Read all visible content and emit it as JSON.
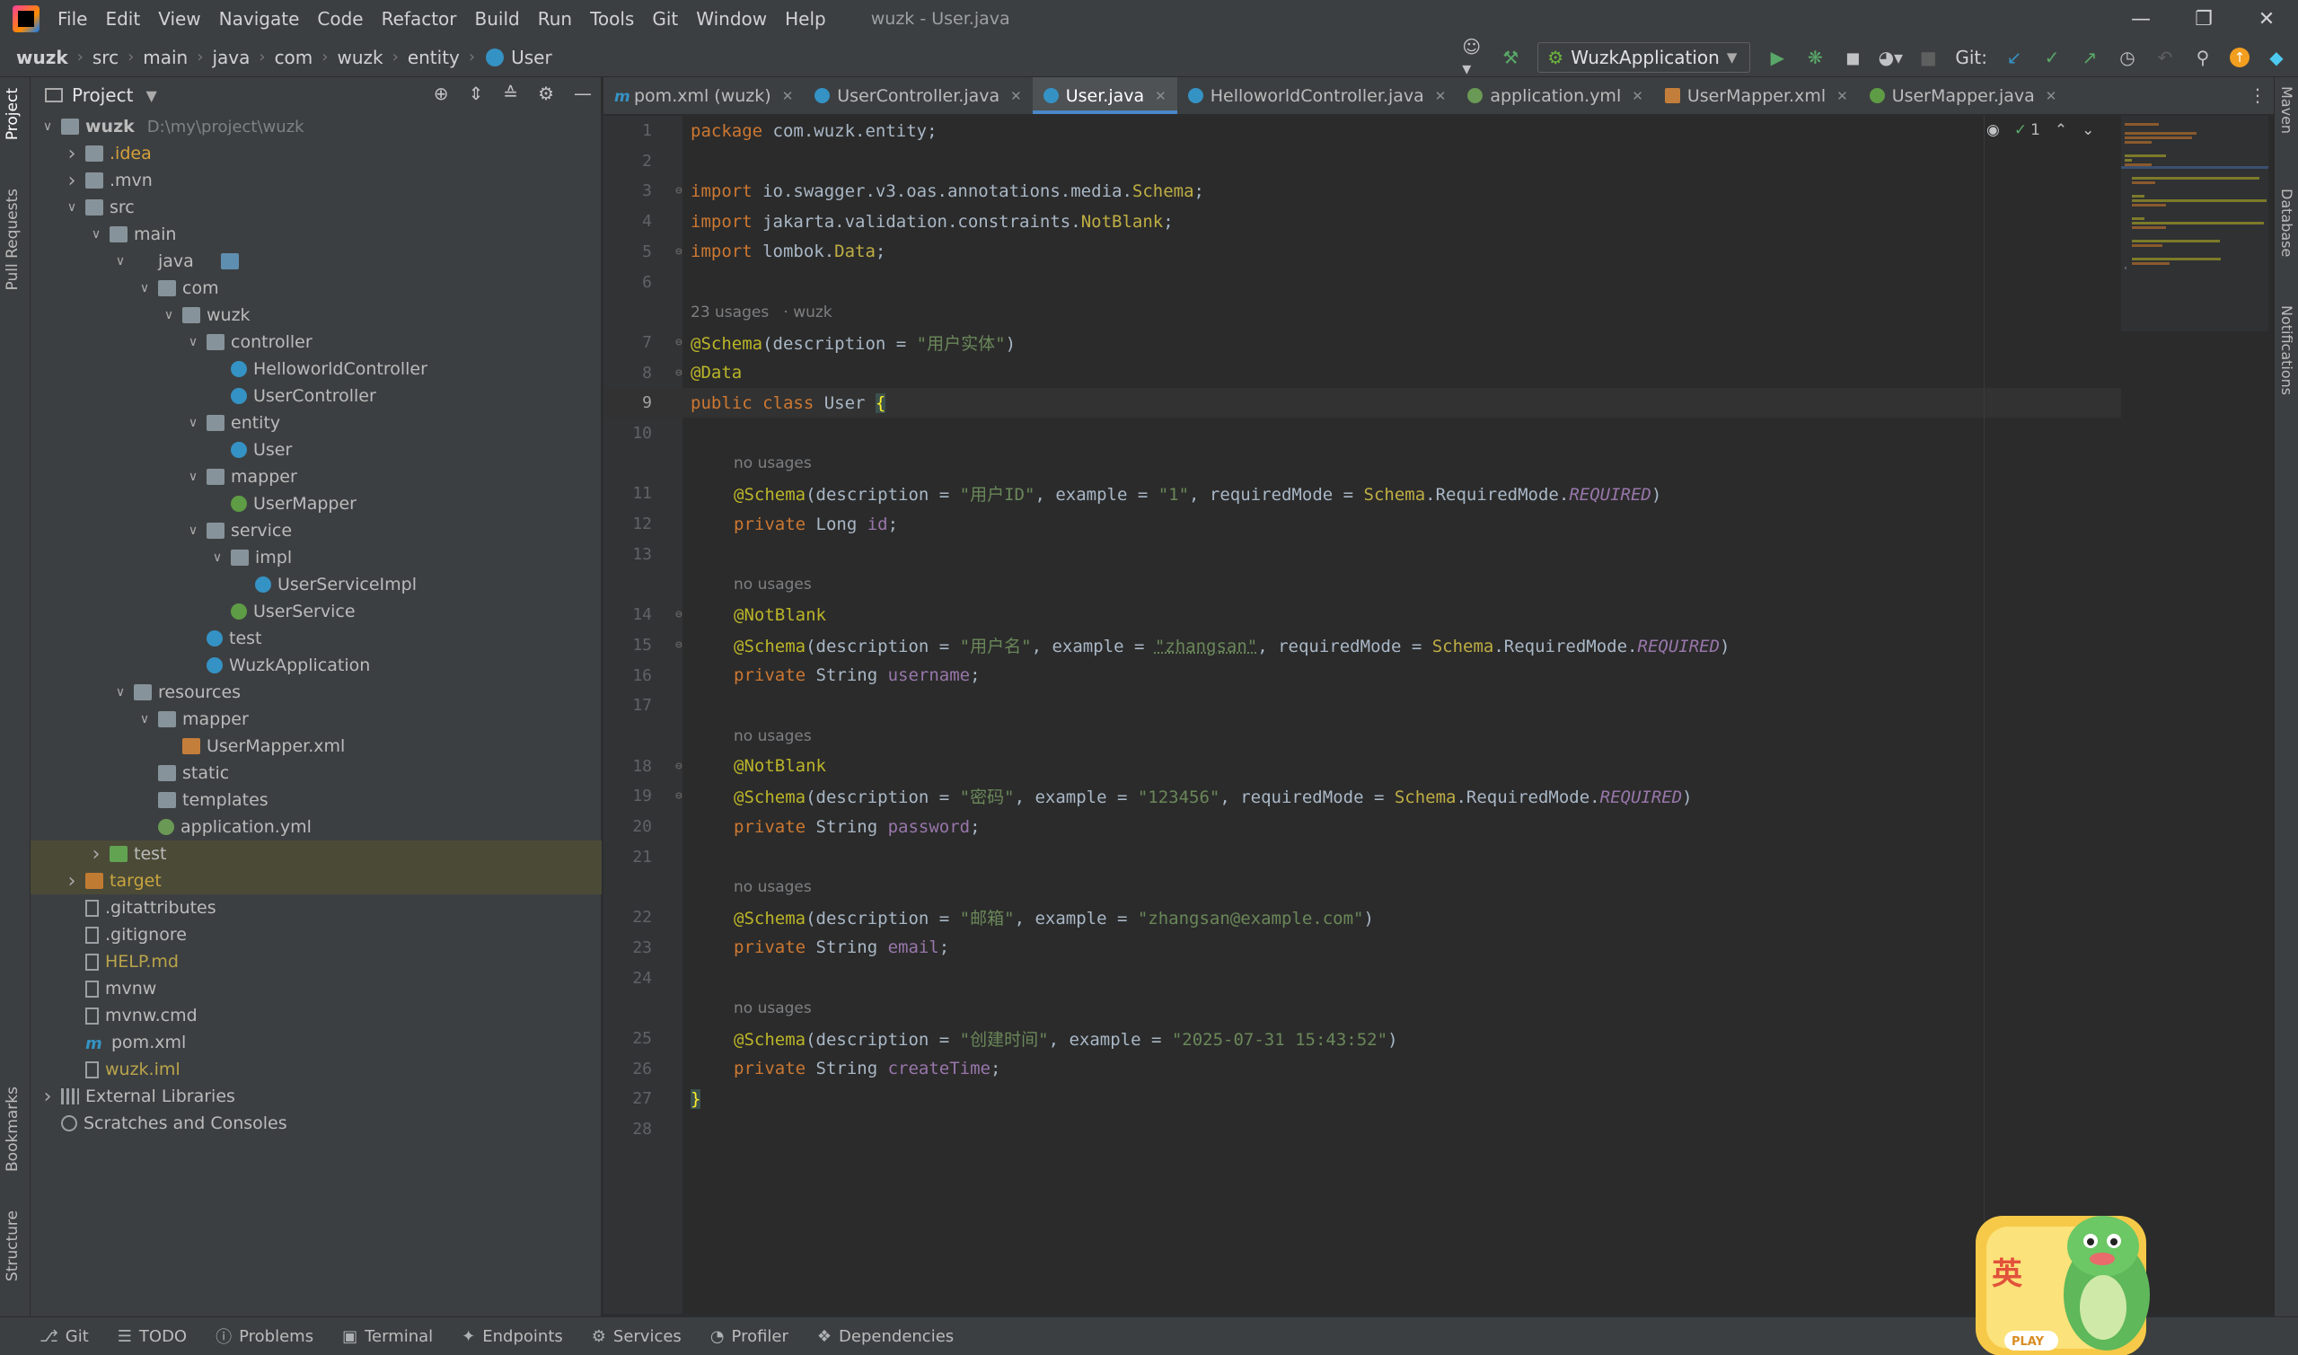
{
  "menubar": {
    "items": [
      "File",
      "Edit",
      "View",
      "Navigate",
      "Code",
      "Refactor",
      "Build",
      "Run",
      "Tools",
      "Git",
      "Window",
      "Help"
    ],
    "window_title": "wuzk - User.java"
  },
  "breadcrumb": [
    "wuzk",
    "src",
    "main",
    "java",
    "com",
    "wuzk",
    "entity",
    "User"
  ],
  "toolbar": {
    "run_config": "WuzkApplication",
    "git_label": "Git:"
  },
  "project_panel": {
    "title": "Project",
    "tree": [
      {
        "depth": 0,
        "label": "wuzk",
        "path": "D:\\my\\project\\wuzk",
        "icon": "module",
        "expanded": true,
        "bold": true
      },
      {
        "depth": 1,
        "label": ".idea",
        "icon": "folder",
        "expanded": false,
        "color": "orange"
      },
      {
        "depth": 1,
        "label": ".mvn",
        "icon": "folder",
        "expanded": false
      },
      {
        "depth": 1,
        "label": "src",
        "icon": "folder",
        "expanded": true
      },
      {
        "depth": 2,
        "label": "main",
        "icon": "folder",
        "expanded": true
      },
      {
        "depth": 3,
        "label": "java",
        "icon": "folder-src",
        "expanded": true
      },
      {
        "depth": 4,
        "label": "com",
        "icon": "folder",
        "expanded": true
      },
      {
        "depth": 5,
        "label": "wuzk",
        "icon": "folder",
        "expanded": true
      },
      {
        "depth": 6,
        "label": "controller",
        "icon": "folder",
        "expanded": true
      },
      {
        "depth": 7,
        "label": "HelloworldController",
        "icon": "class"
      },
      {
        "depth": 7,
        "label": "UserController",
        "icon": "class"
      },
      {
        "depth": 6,
        "label": "entity",
        "icon": "folder",
        "expanded": true
      },
      {
        "depth": 7,
        "label": "User",
        "icon": "class"
      },
      {
        "depth": 6,
        "label": "mapper",
        "icon": "folder",
        "expanded": true
      },
      {
        "depth": 7,
        "label": "UserMapper",
        "icon": "interface"
      },
      {
        "depth": 6,
        "label": "service",
        "icon": "folder",
        "expanded": true
      },
      {
        "depth": 7,
        "label": "impl",
        "icon": "folder",
        "expanded": true
      },
      {
        "depth": 8,
        "label": "UserServiceImpl",
        "icon": "class"
      },
      {
        "depth": 7,
        "label": "UserService",
        "icon": "interface"
      },
      {
        "depth": 6,
        "label": "test",
        "icon": "class"
      },
      {
        "depth": 6,
        "label": "WuzkApplication",
        "icon": "class"
      },
      {
        "depth": 3,
        "label": "resources",
        "icon": "folder",
        "expanded": true
      },
      {
        "depth": 4,
        "label": "mapper",
        "icon": "folder",
        "expanded": true
      },
      {
        "depth": 5,
        "label": "UserMapper.xml",
        "icon": "xml"
      },
      {
        "depth": 4,
        "label": "static",
        "icon": "folder"
      },
      {
        "depth": 4,
        "label": "templates",
        "icon": "folder"
      },
      {
        "depth": 4,
        "label": "application.yml",
        "icon": "yml"
      },
      {
        "depth": 2,
        "label": "test",
        "icon": "folder-green",
        "expanded": false,
        "highlight": true
      },
      {
        "depth": 1,
        "label": "target",
        "icon": "folder-orange",
        "expanded": false,
        "highlight": true,
        "color": "gold"
      },
      {
        "depth": 1,
        "label": ".gitattributes",
        "icon": "file"
      },
      {
        "depth": 1,
        "label": ".gitignore",
        "icon": "file"
      },
      {
        "depth": 1,
        "label": "HELP.md",
        "icon": "file",
        "color": "yellow"
      },
      {
        "depth": 1,
        "label": "mvnw",
        "icon": "file"
      },
      {
        "depth": 1,
        "label": "mvnw.cmd",
        "icon": "file"
      },
      {
        "depth": 1,
        "label": "pom.xml",
        "icon": "maven"
      },
      {
        "depth": 1,
        "label": "wuzk.iml",
        "icon": "file",
        "color": "yellow"
      },
      {
        "depth": 0,
        "label": "External Libraries",
        "icon": "lib",
        "expanded": false
      },
      {
        "depth": 0,
        "label": "Scratches and Consoles",
        "icon": "scratch"
      }
    ]
  },
  "editor_tabs": [
    {
      "label": "pom.xml (wuzk)",
      "icon": "maven",
      "active": false
    },
    {
      "label": "UserController.java",
      "icon": "class",
      "active": false
    },
    {
      "label": "User.java",
      "icon": "class",
      "active": true
    },
    {
      "label": "HelloworldController.java",
      "icon": "class",
      "active": false
    },
    {
      "label": "application.yml",
      "icon": "yml",
      "active": false
    },
    {
      "label": "UserMapper.xml",
      "icon": "xml",
      "active": false
    },
    {
      "label": "UserMapper.java",
      "icon": "interface",
      "active": false
    }
  ],
  "editor": {
    "current_line": 9,
    "inspection_count": "1",
    "lines": [
      {
        "n": 1,
        "tokens": [
          [
            "kw",
            "package "
          ],
          [
            "",
            "com.wuzk.entity;"
          ]
        ]
      },
      {
        "n": 2,
        "tokens": []
      },
      {
        "n": 3,
        "fold": true,
        "tokens": [
          [
            "kw",
            "import "
          ],
          [
            "",
            "io.swagger.v3.oas.annotations.media."
          ],
          [
            "ty2",
            "Schema"
          ],
          [
            "",
            ";"
          ]
        ]
      },
      {
        "n": 4,
        "tokens": [
          [
            "kw",
            "import "
          ],
          [
            "",
            "jakarta.validation.constraints."
          ],
          [
            "ty2",
            "NotBlank"
          ],
          [
            "",
            ";"
          ]
        ]
      },
      {
        "n": 5,
        "fold": true,
        "tokens": [
          [
            "kw",
            "import "
          ],
          [
            "",
            "lombok."
          ],
          [
            "ty2",
            "Data"
          ],
          [
            "",
            ";"
          ]
        ]
      },
      {
        "n": 6,
        "tokens": []
      },
      {
        "hint": "23 usages   · wuzk"
      },
      {
        "n": 7,
        "fold": true,
        "tokens": [
          [
            "an",
            "@Schema"
          ],
          [
            "",
            "(description = "
          ],
          [
            "st",
            "\"用户实体\""
          ],
          [
            "",
            ")"
          ]
        ]
      },
      {
        "n": 8,
        "fold": true,
        "tokens": [
          [
            "an",
            "@Data"
          ]
        ]
      },
      {
        "n": 9,
        "tokens": [
          [
            "kw",
            "public class "
          ],
          [
            "",
            "User "
          ],
          [
            "brace",
            "{"
          ]
        ]
      },
      {
        "n": 10,
        "tokens": []
      },
      {
        "hint": "no usages",
        "indent": true
      },
      {
        "n": 11,
        "indent": true,
        "tokens": [
          [
            "an",
            "@Schema"
          ],
          [
            "",
            "(description = "
          ],
          [
            "st",
            "\"用户ID\""
          ],
          [
            "",
            ", example = "
          ],
          [
            "st",
            "\"1\""
          ],
          [
            "",
            ", requiredMode = "
          ],
          [
            "ty2",
            "Schema"
          ],
          [
            "",
            ".RequiredMode."
          ],
          [
            "en",
            "REQUIRED"
          ],
          [
            "",
            ")"
          ]
        ]
      },
      {
        "n": 12,
        "indent": true,
        "tokens": [
          [
            "kw",
            "private "
          ],
          [
            "",
            "Long "
          ],
          [
            "fld",
            "id"
          ],
          [
            "",
            ";"
          ]
        ]
      },
      {
        "n": 13,
        "tokens": []
      },
      {
        "hint": "no usages",
        "indent": true
      },
      {
        "n": 14,
        "fold": true,
        "indent": true,
        "tokens": [
          [
            "an",
            "@NotBlank"
          ]
        ]
      },
      {
        "n": 15,
        "fold": true,
        "indent": true,
        "tokens": [
          [
            "an",
            "@Schema"
          ],
          [
            "",
            "(description = "
          ],
          [
            "st",
            "\"用户名\""
          ],
          [
            "",
            ", example = "
          ],
          [
            "st",
            "\"zhangsan\""
          ],
          [
            "",
            ", requiredMode = "
          ],
          [
            "ty2",
            "Schema"
          ],
          [
            "",
            ".RequiredMode."
          ],
          [
            "en",
            "REQUIRED"
          ],
          [
            "",
            ")"
          ]
        ]
      },
      {
        "n": 16,
        "indent": true,
        "tokens": [
          [
            "kw",
            "private "
          ],
          [
            "",
            "String "
          ],
          [
            "fld",
            "username"
          ],
          [
            "",
            ";"
          ]
        ]
      },
      {
        "n": 17,
        "tokens": []
      },
      {
        "hint": "no usages",
        "indent": true
      },
      {
        "n": 18,
        "fold": true,
        "indent": true,
        "tokens": [
          [
            "an",
            "@NotBlank"
          ]
        ]
      },
      {
        "n": 19,
        "fold": true,
        "indent": true,
        "tokens": [
          [
            "an",
            "@Schema"
          ],
          [
            "",
            "(description = "
          ],
          [
            "st",
            "\"密码\""
          ],
          [
            "",
            ", example = "
          ],
          [
            "st",
            "\"123456\""
          ],
          [
            "",
            ", requiredMode = "
          ],
          [
            "ty2",
            "Schema"
          ],
          [
            "",
            ".RequiredMode."
          ],
          [
            "en",
            "REQUIRED"
          ],
          [
            "",
            ")"
          ]
        ]
      },
      {
        "n": 20,
        "indent": true,
        "tokens": [
          [
            "kw",
            "private "
          ],
          [
            "",
            "String "
          ],
          [
            "fld",
            "password"
          ],
          [
            "",
            ";"
          ]
        ]
      },
      {
        "n": 21,
        "tokens": []
      },
      {
        "hint": "no usages",
        "indent": true
      },
      {
        "n": 22,
        "indent": true,
        "tokens": [
          [
            "an",
            "@Schema"
          ],
          [
            "",
            "(description = "
          ],
          [
            "st",
            "\"邮箱\""
          ],
          [
            "",
            ", example = "
          ],
          [
            "st",
            "\"zhangsan@example.com\""
          ],
          [
            "",
            ")"
          ]
        ]
      },
      {
        "n": 23,
        "indent": true,
        "tokens": [
          [
            "kw",
            "private "
          ],
          [
            "",
            "String "
          ],
          [
            "fld",
            "email"
          ],
          [
            "",
            ";"
          ]
        ]
      },
      {
        "n": 24,
        "tokens": []
      },
      {
        "hint": "no usages",
        "indent": true
      },
      {
        "n": 25,
        "indent": true,
        "tokens": [
          [
            "an",
            "@Schema"
          ],
          [
            "",
            "(description = "
          ],
          [
            "st",
            "\"创建时间\""
          ],
          [
            "",
            ", example = "
          ],
          [
            "st",
            "\"2025-07-31 15:43:52\""
          ],
          [
            "",
            ")"
          ]
        ]
      },
      {
        "n": 26,
        "indent": true,
        "tokens": [
          [
            "kw",
            "private "
          ],
          [
            "",
            "String "
          ],
          [
            "fld",
            "createTime"
          ],
          [
            "",
            ";"
          ]
        ]
      },
      {
        "n": 27,
        "tokens": [
          [
            "brace",
            "}"
          ]
        ]
      },
      {
        "n": 28,
        "tokens": []
      }
    ]
  },
  "left_stripe": [
    "Project",
    "Pull Requests",
    "Bookmarks",
    "Structure"
  ],
  "right_stripe": [
    "Maven",
    "Database",
    "Notifications"
  ],
  "bottom_tools": [
    "Git",
    "TODO",
    "Problems",
    "Terminal",
    "Endpoints",
    "Services",
    "Profiler",
    "Dependencies"
  ],
  "mascot": {
    "badge_text": "PLAY",
    "glyph": "英"
  },
  "colors": {
    "accent": "#4a88c7",
    "editor_bg": "#2b2b2b",
    "panel_bg": "#3c3f41"
  }
}
